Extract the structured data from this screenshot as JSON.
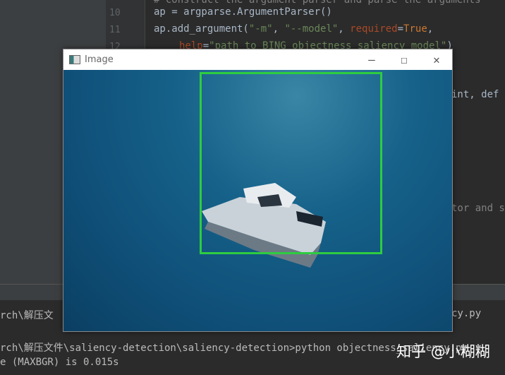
{
  "editor": {
    "lines": [
      {
        "num": "10",
        "code": "ap = argparse.ArgumentParser()"
      },
      {
        "num": "11",
        "code_parts": [
          "ap.add_argument(",
          "\"-m\"",
          ", ",
          "\"--model\"",
          ", ",
          "required",
          "=",
          "True",
          ","
        ]
      },
      {
        "num": "12",
        "code_parts": [
          "help",
          "=",
          "\"path to BING objectness saliency model\"",
          ")"
        ]
      }
    ],
    "partial_top": "# construct the argument parser and parse the arguments",
    "partial_right_1": "int, def",
    "partial_right_2": "tor and s"
  },
  "terminal": {
    "lines": [
      "rch\\解压文",
      "cy.py",
      "rch\\解压文件\\saliency-detection\\saliency-detection>python objectness_saliency.py",
      "e (MAXBGR) is 0.015s"
    ]
  },
  "window": {
    "title": "Image",
    "minimize": "–",
    "maximize": "☐",
    "close": "✕"
  },
  "watermark": "知乎 @小糊糊",
  "colors": {
    "box": "#2ecc40"
  }
}
